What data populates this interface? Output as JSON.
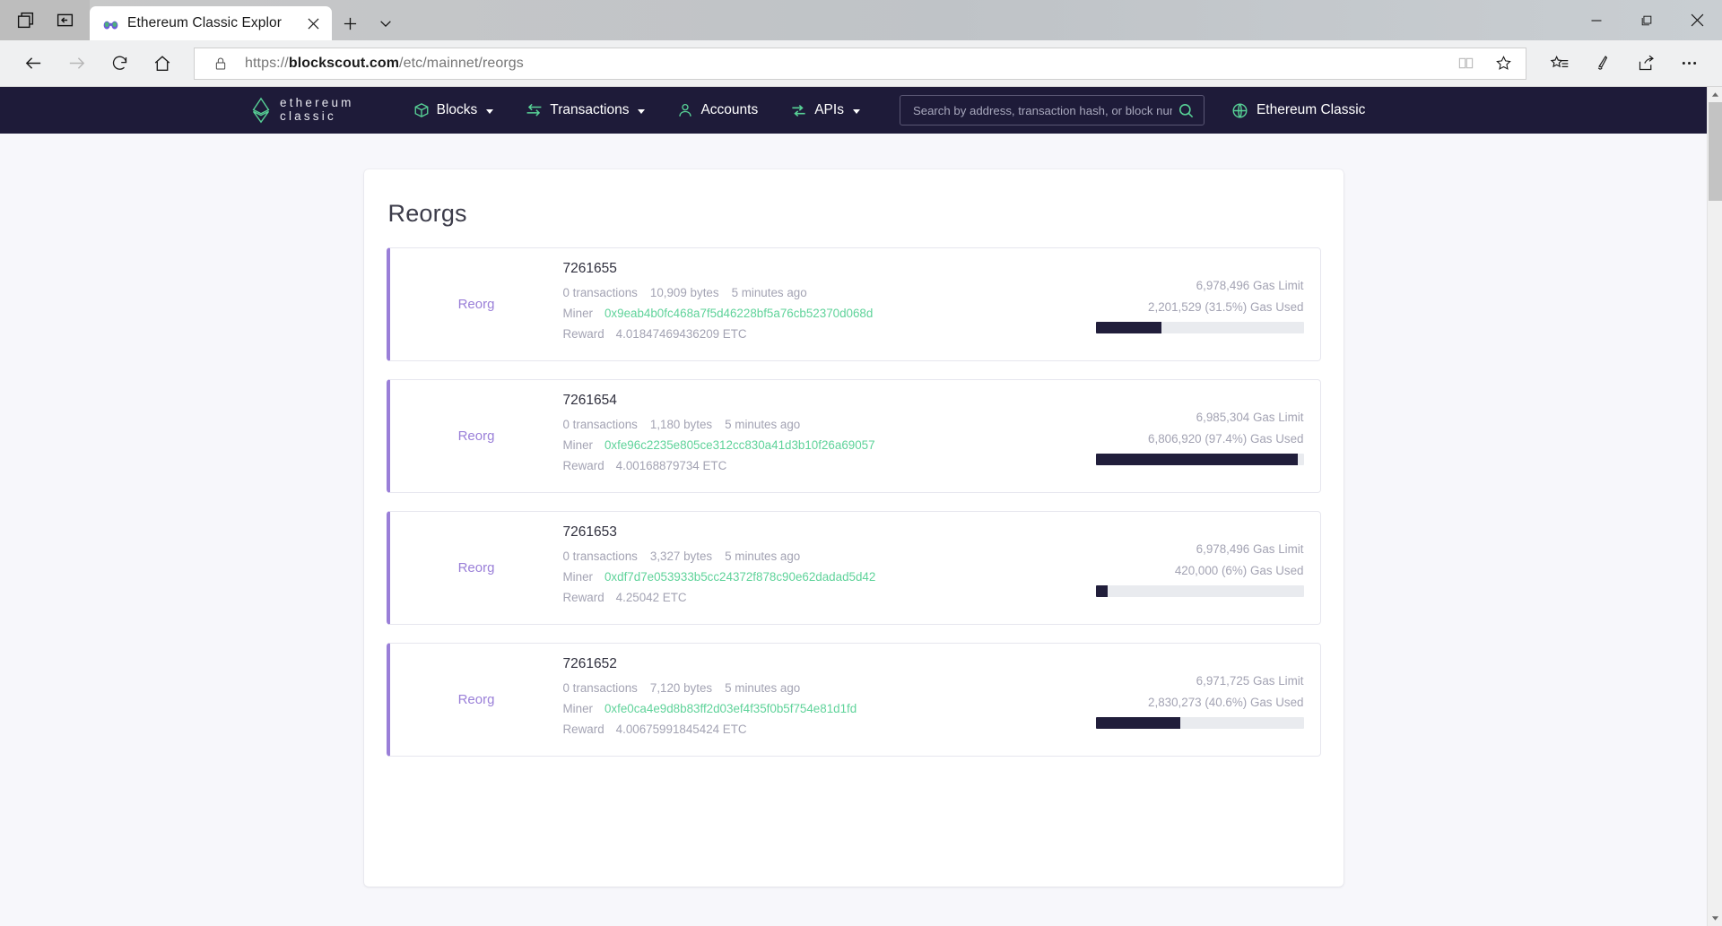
{
  "browser": {
    "tab": {
      "title": "Ethereum Classic Explor",
      "favicon_name": "binoculars-favicon",
      "close_label": "✕"
    },
    "new_tab_label": "+",
    "tab_menu_label": "⌄",
    "window_controls": {
      "minimize": "─",
      "maximize": "❐",
      "close": "✕"
    },
    "toolbar": {
      "back_label": "←",
      "forward_label": "→",
      "refresh_label": "↻",
      "home_label": "⌂",
      "reading_view_label": "📖",
      "favorite_label": "☆",
      "hub_label": "☆≡",
      "notes_label": "✎",
      "share_label": "↗",
      "more_label": "⋯"
    },
    "url": {
      "scheme": "https://",
      "host": "blockscout.com",
      "path": "/etc/mainnet/reorgs",
      "lock_icon": "lock-icon"
    }
  },
  "site": {
    "brand": {
      "line1": "ethereum",
      "line2": "classic",
      "logo_name": "ethereum-classic-logo"
    },
    "nav_items": [
      {
        "label": "Blocks",
        "icon": "cube-icon",
        "has_caret": true
      },
      {
        "label": "Transactions",
        "icon": "arrow-exchange-icon",
        "has_caret": true
      },
      {
        "label": "Accounts",
        "icon": "user-icon",
        "has_caret": false
      },
      {
        "label": "APIs",
        "icon": "sliders-icon",
        "has_caret": true
      }
    ],
    "search": {
      "placeholder": "Search by address, transaction hash, or block number",
      "value": "",
      "button_icon": "search-icon"
    },
    "network": {
      "label": "Ethereum Classic",
      "icon": "globe-icon",
      "has_caret": true
    }
  },
  "main": {
    "title": "Reorgs",
    "labels": {
      "badge": "Reorg",
      "transactions_suffix": "transactions",
      "bytes_suffix": "bytes",
      "miner_key": "Miner",
      "reward_key": "Reward",
      "gas_limit_suffix": "Gas Limit",
      "gas_used_suffix": "Gas Used"
    },
    "reorgs": [
      {
        "badge": "Reorg",
        "number": "7261655",
        "transactions": "0 transactions",
        "size": "10,909 bytes",
        "age": "5 minutes ago",
        "miner_key": "Miner",
        "miner": "0x9eab4b0fc468a7f5d46228bf5a76cb52370d068d",
        "reward_key": "Reward",
        "reward": "4.01847469436209 ETC",
        "gas_limit": "6,978,496 Gas Limit",
        "gas_used": "2,201,529 (31.5%) Gas Used",
        "gas_percent": 31.5
      },
      {
        "badge": "Reorg",
        "number": "7261654",
        "transactions": "0 transactions",
        "size": "1,180 bytes",
        "age": "5 minutes ago",
        "miner_key": "Miner",
        "miner": "0xfe96c2235e805ce312cc830a41d3b10f26a69057",
        "reward_key": "Reward",
        "reward": "4.00168879734 ETC",
        "gas_limit": "6,985,304 Gas Limit",
        "gas_used": "6,806,920 (97.4%) Gas Used",
        "gas_percent": 97.4
      },
      {
        "badge": "Reorg",
        "number": "7261653",
        "transactions": "0 transactions",
        "size": "3,327 bytes",
        "age": "5 minutes ago",
        "miner_key": "Miner",
        "miner": "0xdf7d7e053933b5cc24372f878c90e62dadad5d42",
        "reward_key": "Reward",
        "reward": "4.25042 ETC",
        "gas_limit": "6,978,496 Gas Limit",
        "gas_used": "420,000 (6%) Gas Used",
        "gas_percent": 6
      },
      {
        "badge": "Reorg",
        "number": "7261652",
        "transactions": "0 transactions",
        "size": "7,120 bytes",
        "age": "5 minutes ago",
        "miner_key": "Miner",
        "miner": "0xfe0ca4e9d8b83ff2d03ef4f35f0b5f754e81d1fd",
        "reward_key": "Reward",
        "reward": "4.00675991845424 ETC",
        "gas_limit": "6,971,725 Gas Limit",
        "gas_used": "2,830,273 (40.6%) Gas Used",
        "gas_percent": 40.6
      }
    ]
  },
  "colors": {
    "navbar_bg": "#1e1b39",
    "accent_green": "#57d196",
    "reorg_purple": "#9a7fd8",
    "gas_bar_fill": "#211e3b"
  }
}
